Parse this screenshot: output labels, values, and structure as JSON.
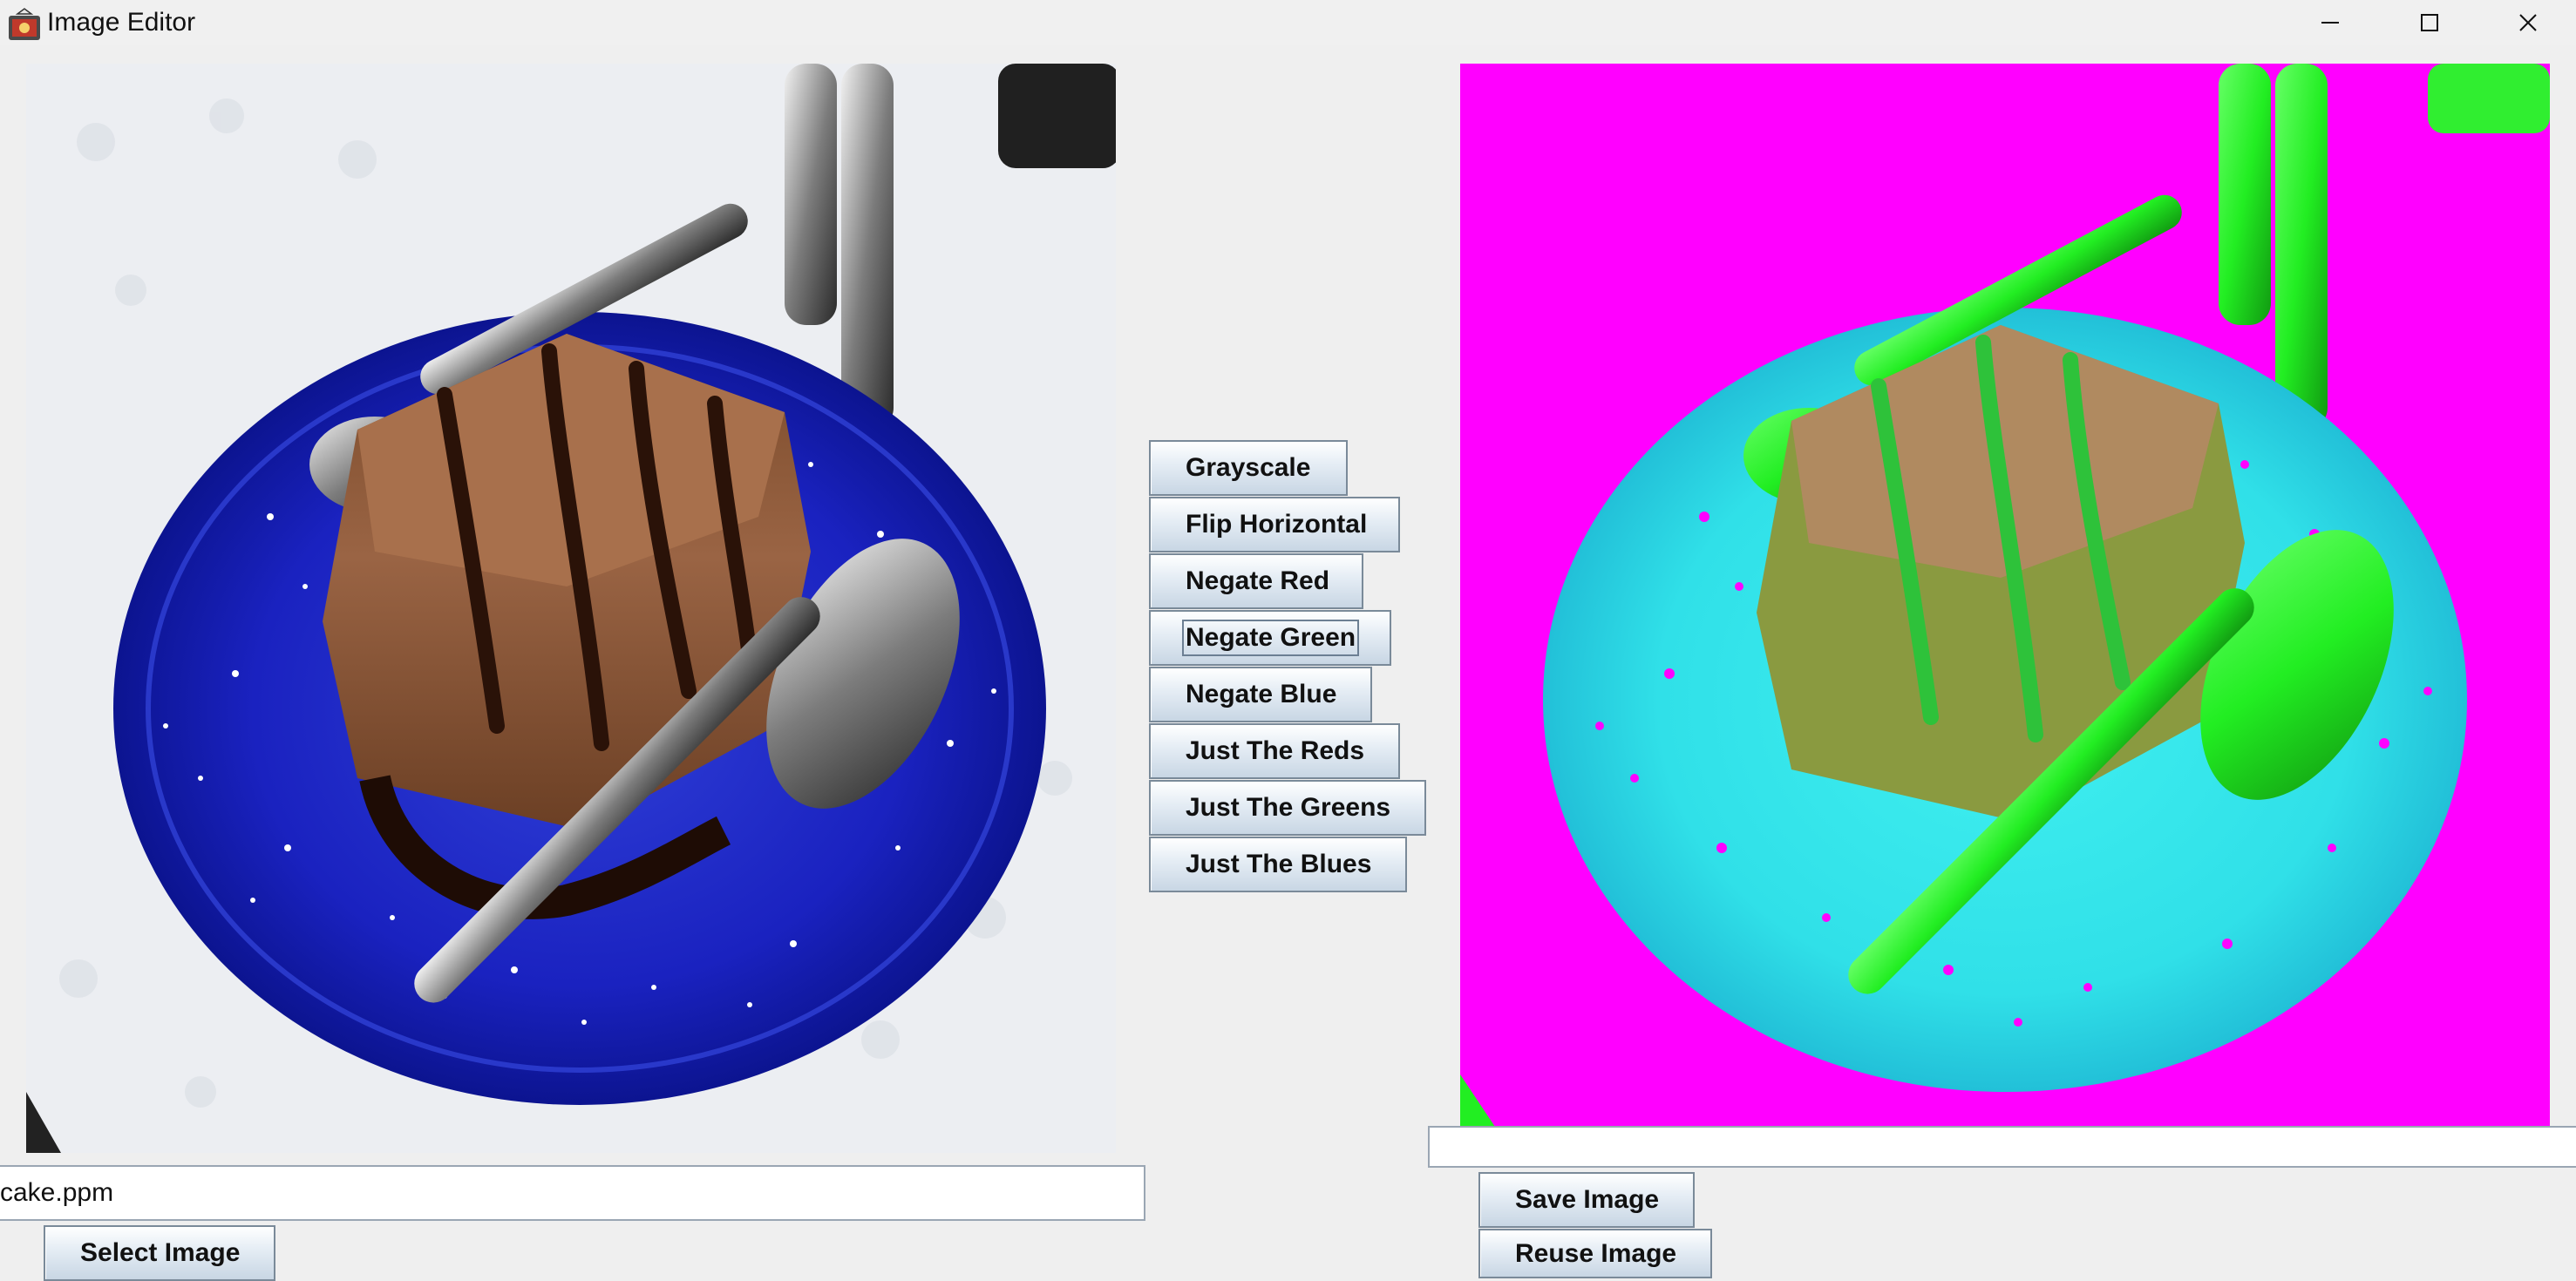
{
  "window": {
    "title": "Image Editor",
    "controls": [
      "minimize-icon",
      "maximize-icon",
      "close-icon"
    ]
  },
  "left_panel": {
    "image_desc": "original photo of chocolate cake on blue plate",
    "filename_value": "cake.ppm",
    "select_label": "Select Image"
  },
  "operations": {
    "buttons": [
      {
        "label": "Grayscale"
      },
      {
        "label": "Flip Horizontal"
      },
      {
        "label": "Negate Red"
      },
      {
        "label": "Negate Green"
      },
      {
        "label": "Negate Blue"
      },
      {
        "label": "Just The Reds"
      },
      {
        "label": "Just The Greens"
      },
      {
        "label": "Just The Blues"
      }
    ]
  },
  "right_panel": {
    "image_desc": "processed photo with negated green channel",
    "filename_value": "",
    "save_label": "Save Image",
    "reuse_label": "Reuse Image"
  },
  "colors": {
    "background": "#efefef",
    "button_border": "#7a8a99",
    "processed_bg": "#ff00ff"
  }
}
